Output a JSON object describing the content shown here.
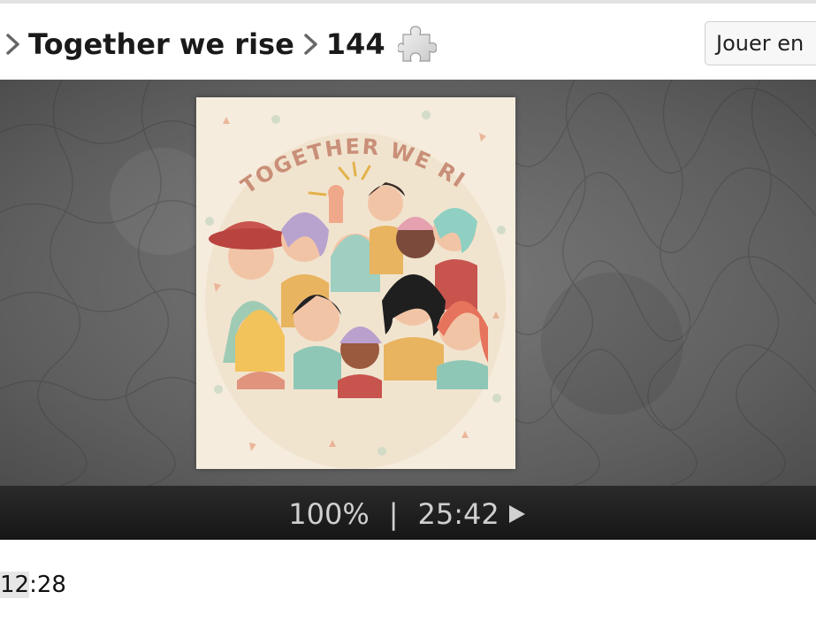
{
  "breadcrumb": {
    "items": [
      {
        "label": "Together we rise"
      },
      {
        "label": "144"
      }
    ]
  },
  "header": {
    "play_button_label": "Jouer en"
  },
  "puzzle": {
    "image_title_text": "TOGETHER WE RISE."
  },
  "status": {
    "progress_text": "100%",
    "separator": "|",
    "elapsed_time": "25:42"
  },
  "footer": {
    "timer_highlighted": "12",
    "timer_rest": ":28"
  },
  "colors": {
    "stage_bg": "#5e5e5e",
    "bar_bg": "#1f1f1f",
    "status_text": "#cfcfcf",
    "poster_bg": "#f5ecdd"
  },
  "icons": [
    "chevron-right-icon",
    "puzzle-piece-icon",
    "play-icon"
  ]
}
